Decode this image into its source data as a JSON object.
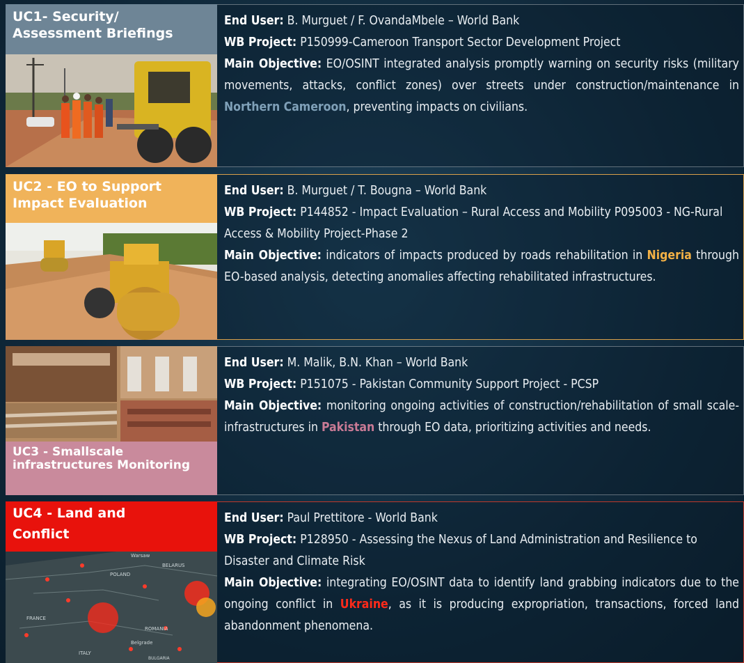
{
  "cases": [
    {
      "title": "UC1- Security/ Assessment Briefings",
      "color": "#5a7488",
      "end_user_label": "End User:",
      "end_user": " B. Murguet / F. OvandaMbele – World Bank",
      "project_label": "WB Project:",
      "project": " P150999-Cameroon Transport Sector Development Project",
      "objective_label": "Main Objective:",
      "objective_pre": " EO/OSINT integrated analysis promptly warning on security risks  (military movements, attacks, conflict zones) over streets under construction/maintenance in ",
      "objective_hl": "Northern Cameroon",
      "objective_post": ", preventing impacts on civilians."
    },
    {
      "title": "UC2 - EO to Support Impact Evaluation",
      "color": "#f0b35a",
      "end_user_label": "End User:",
      "end_user": " B. Murguet / T. Bougna – World Bank",
      "project_label": "WB Project:",
      "project": " P144852 - Impact Evaluation – Rural Access and Mobility P095003 - NG-Rural Access & Mobility Project-Phase 2",
      "objective_label": "Main Objective:",
      "objective_pre": " indicators of impacts produced by roads rehabilitation in ",
      "objective_hl": "Nigeria",
      "objective_post": " through EO-based analysis, detecting anomalies affecting rehabilitated infrastructures."
    },
    {
      "title": "UC3 - Smallscale infrastructures Monitoring",
      "color": "#c98a9c",
      "end_user_label": "End User:",
      "end_user": " M. Malik, B.N. Khan – World Bank",
      "project_label": "WB Project:",
      "project": " P151075 - Pakistan Community Support Project - PCSP",
      "objective_label": "Main Objective:",
      "objective_pre": " monitoring ongoing activities of construction/rehabilitation of small scale-infrastructures in ",
      "objective_hl": "Pakistan",
      "objective_post": " through EO data, prioritizing activities and needs."
    },
    {
      "title": "UC4 - Land and Conflict",
      "color": "#e8120c",
      "end_user_label": "End User:",
      "end_user": " Paul Prettitore - World Bank",
      "project_label": "WB Project:",
      "project": " P128950 - Assessing the Nexus of Land Administration and Resilience to Disaster and Climate Risk",
      "objective_label": "Main Objective:",
      "objective_pre": " integrating EO/OSINT data to identify land grabbing indicators due to the ongoing conflict in ",
      "objective_hl": "Ukraine",
      "objective_post": ", as it is producing expropriation, transactions, forced land abandonment phenomena."
    }
  ],
  "map_labels": {
    "belarus": "BELARUS",
    "poland": "POLAND",
    "france": "FRANCE",
    "romania": "ROMANIA",
    "warsaw": "Warsaw",
    "belgrade": "Belgrade",
    "italy": "ITALY",
    "bulgaria": "BULGARIA"
  }
}
